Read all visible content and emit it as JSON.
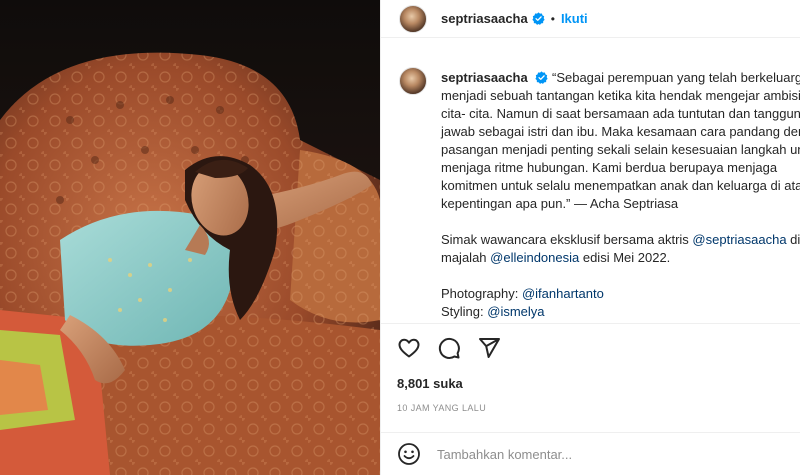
{
  "post": {
    "username": "septriasaacha",
    "follow_label": "Ikuti",
    "separator": "•",
    "caption_lines": [
      "“Sebagai perempuan yang telah berkeluarga,",
      "menjadi sebuah tantangan ketika kita hendak mengejar ambisi dan",
      "cita- cita. Namun di saat bersamaan ada tuntutan dan tanggung",
      "jawab sebagai istri dan ibu. Maka kesamaan cara pandang dengan",
      "pasangan menjadi penting sekali selain kesesuaian langkah untuk",
      "menjaga ritme hubungan. Kami berdua berupaya menjaga",
      "komitmen untuk selalu menempatkan anak dan keluarga di atas",
      "kepentingan apa pun.” — Acha Septriasa"
    ],
    "interview_text_1": "Simak wawancara eksklusif bersama aktris ",
    "interview_mention": "@septriasaacha",
    "interview_text_2": " di",
    "magazine_text_1": "majalah ",
    "magazine_mention": "@elleindonesia",
    "magazine_text_2": " edisi Mei 2022.",
    "photography_label": "Photography: ",
    "photography_mention": "@ifanhartanto",
    "styling_label": "Styling: ",
    "styling_mention": "@ismelya",
    "likes": "8,801 suka",
    "time": "10 JAM YANG LALU",
    "comment_placeholder": "Tambahkan komentar..."
  },
  "icons": {
    "verified": "verified-badge-icon",
    "like": "heart-icon",
    "comment": "comment-bubble-icon",
    "share": "paper-plane-icon",
    "emoji": "smiley-icon"
  },
  "colors": {
    "link_blue": "#0095f6",
    "mention": "#00376b",
    "muted": "#8e8e8e"
  }
}
